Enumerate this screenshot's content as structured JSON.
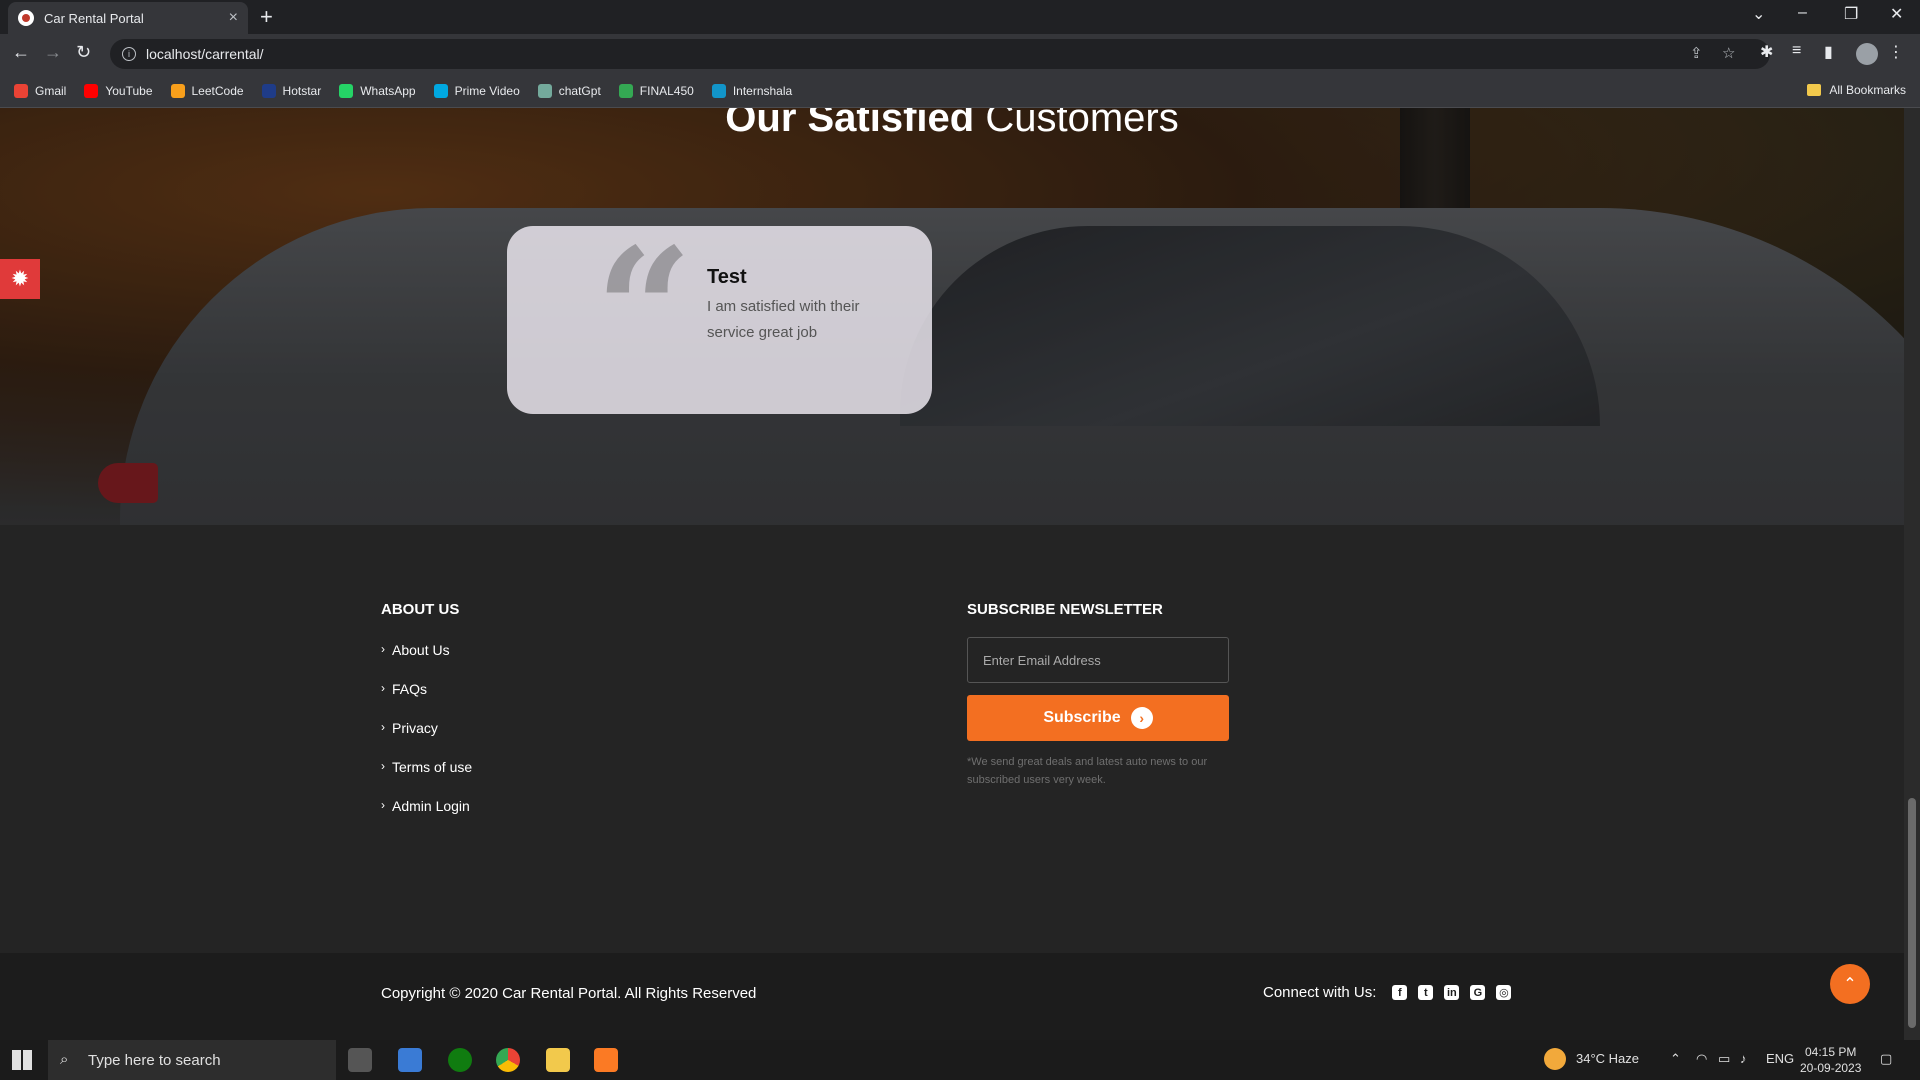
{
  "browser": {
    "tab_title": "Car Rental Portal",
    "tab_close": "×",
    "new_tab": "+",
    "url": "localhost/carrental/",
    "bookmarks": [
      {
        "label": "Gmail",
        "color": "#ea4335"
      },
      {
        "label": "YouTube",
        "color": "#ff0000"
      },
      {
        "label": "LeetCode",
        "color": "#f89f1b"
      },
      {
        "label": "Hotstar",
        "color": "#1f3c88"
      },
      {
        "label": "WhatsApp",
        "color": "#25d366"
      },
      {
        "label": "Prime Video",
        "color": "#00a8e1"
      },
      {
        "label": "chatGpt",
        "color": "#74aa9c"
      },
      {
        "label": "FINAL450",
        "color": "#34a853"
      },
      {
        "label": "Internshala",
        "color": "#1295c9"
      }
    ],
    "all_bookmarks": "All Bookmarks"
  },
  "testimonials": {
    "title_bold": "Our Satisfied",
    "title_light": "Customers",
    "card": {
      "name": "Test",
      "text": "I am satisfied with their service great job"
    }
  },
  "footer": {
    "about_heading": "ABOUT US",
    "links": [
      "About Us",
      "FAQs",
      "Privacy",
      "Terms of use",
      "Admin Login"
    ],
    "newsletter_heading": "SUBSCRIBE NEWSLETTER",
    "email_placeholder": "Enter Email Address",
    "subscribe_label": "Subscribe",
    "note": "*We send great deals and latest auto news to our subscribed users very week.",
    "copyright": "Copyright © 2020 Car Rental Portal. All Rights Reserved",
    "connect_label": "Connect with Us:",
    "social": [
      "facebook-icon",
      "twitter-icon",
      "linkedin-icon",
      "google-plus-icon",
      "instagram-icon"
    ]
  },
  "taskbar": {
    "search_placeholder": "Type here to search",
    "weather": "34°C  Haze",
    "language": "ENG",
    "time": "04:15 PM",
    "date": "20-09-2023"
  },
  "colors": {
    "accent": "#f36f21",
    "settings_tab": "#e03a3a"
  }
}
